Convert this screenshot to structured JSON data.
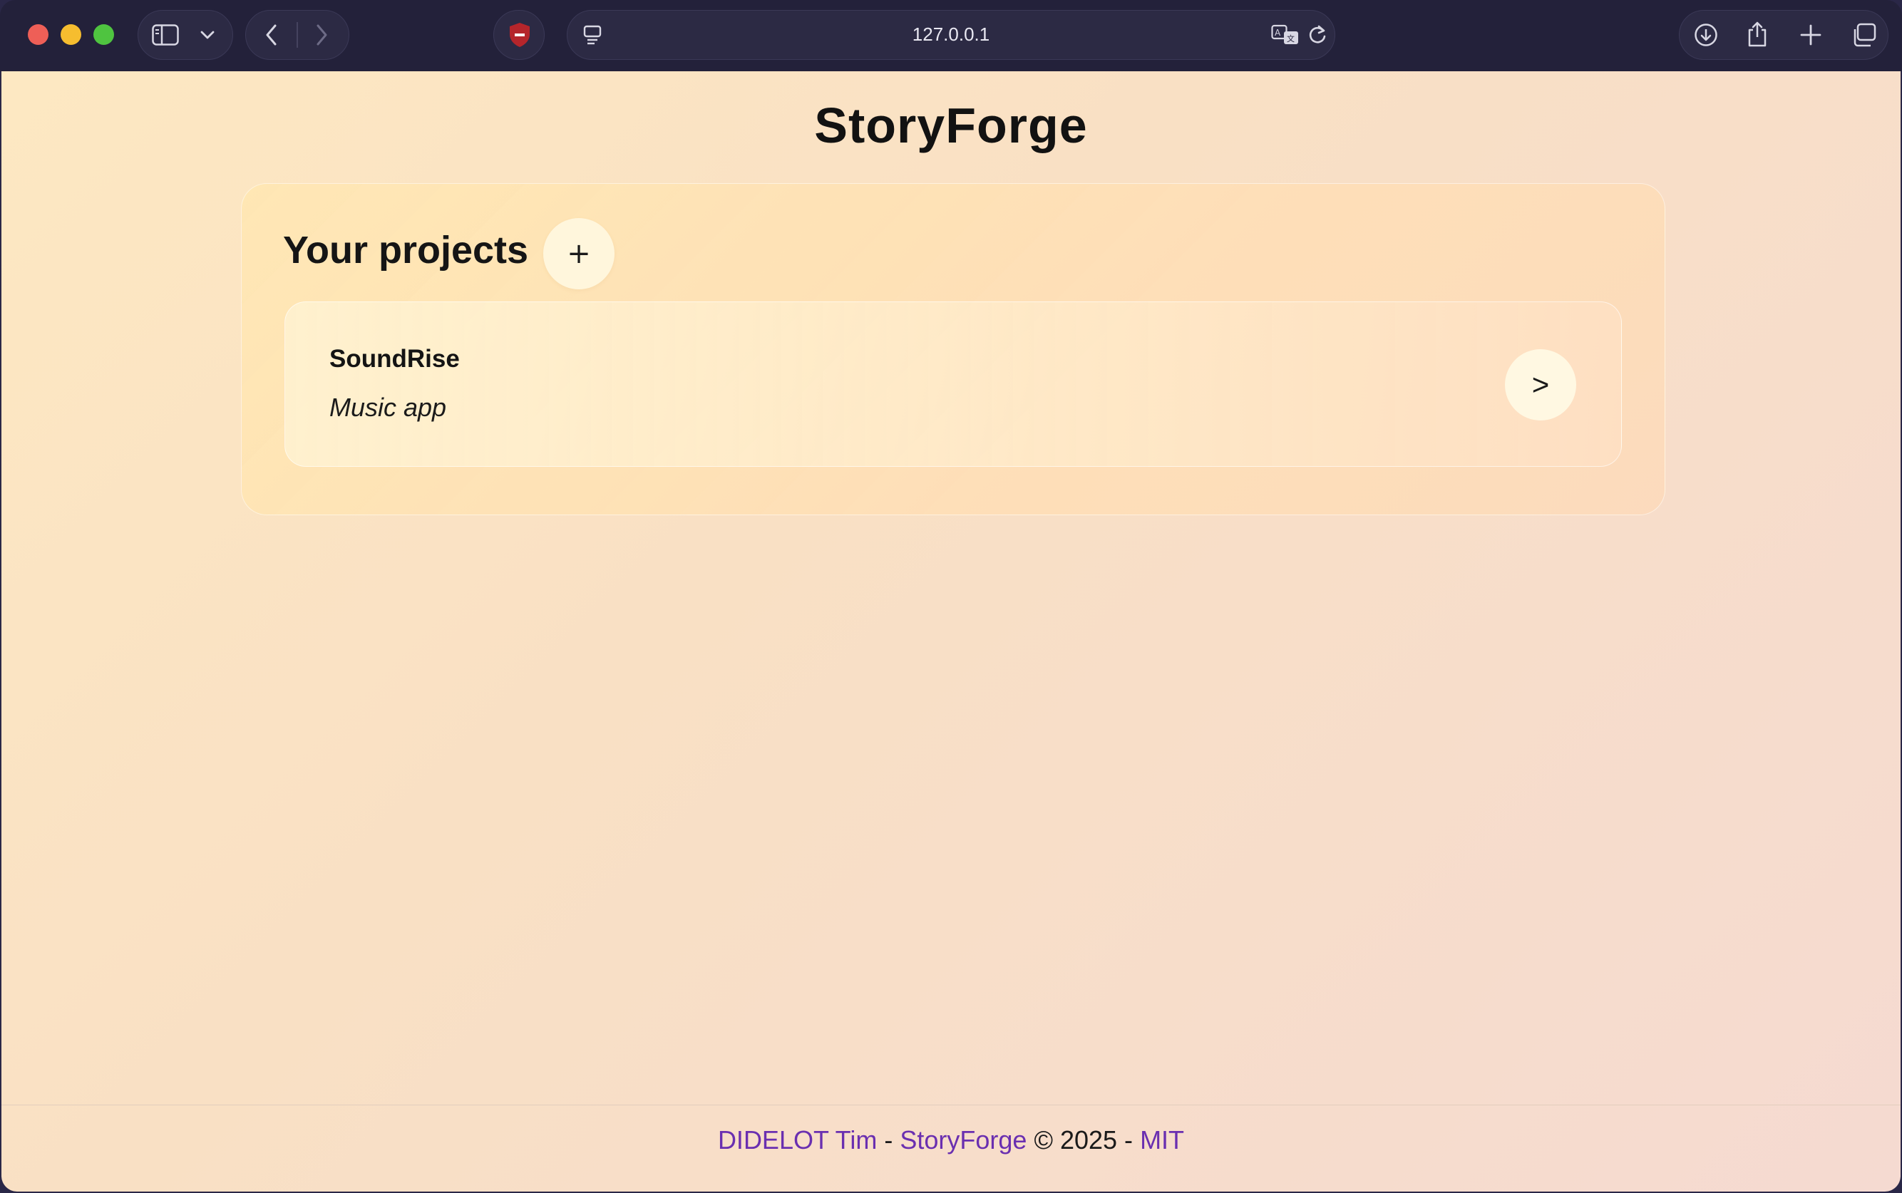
{
  "browser": {
    "address": "127.0.0.1",
    "icons": {
      "sidebar": "sidebar-icon",
      "chevron": "chevron-down-icon",
      "back": "back-arrow-icon",
      "forward": "forward-arrow-icon",
      "shield": "shield-icon",
      "reader": "reader-icon",
      "translate": "translate-icon",
      "reload": "reload-icon",
      "download": "download-icon",
      "share": "share-icon",
      "new_tab": "plus-icon",
      "tabs": "tabs-overview-icon"
    }
  },
  "page": {
    "site_title": "StoryForge",
    "projects": {
      "heading": "Your projects",
      "add_label": "+",
      "items": [
        {
          "name": "SoundRise",
          "description": "Music app",
          "open_label": ">"
        }
      ]
    },
    "footer": {
      "author": "DIDELOT Tim",
      "sep1": "-",
      "project": "StoryForge",
      "copyright": "© 2025 -",
      "license": "MIT"
    }
  },
  "colors": {
    "link": "#6a2fb0",
    "toolbar": "#23213a",
    "shield": "#b5252b"
  }
}
